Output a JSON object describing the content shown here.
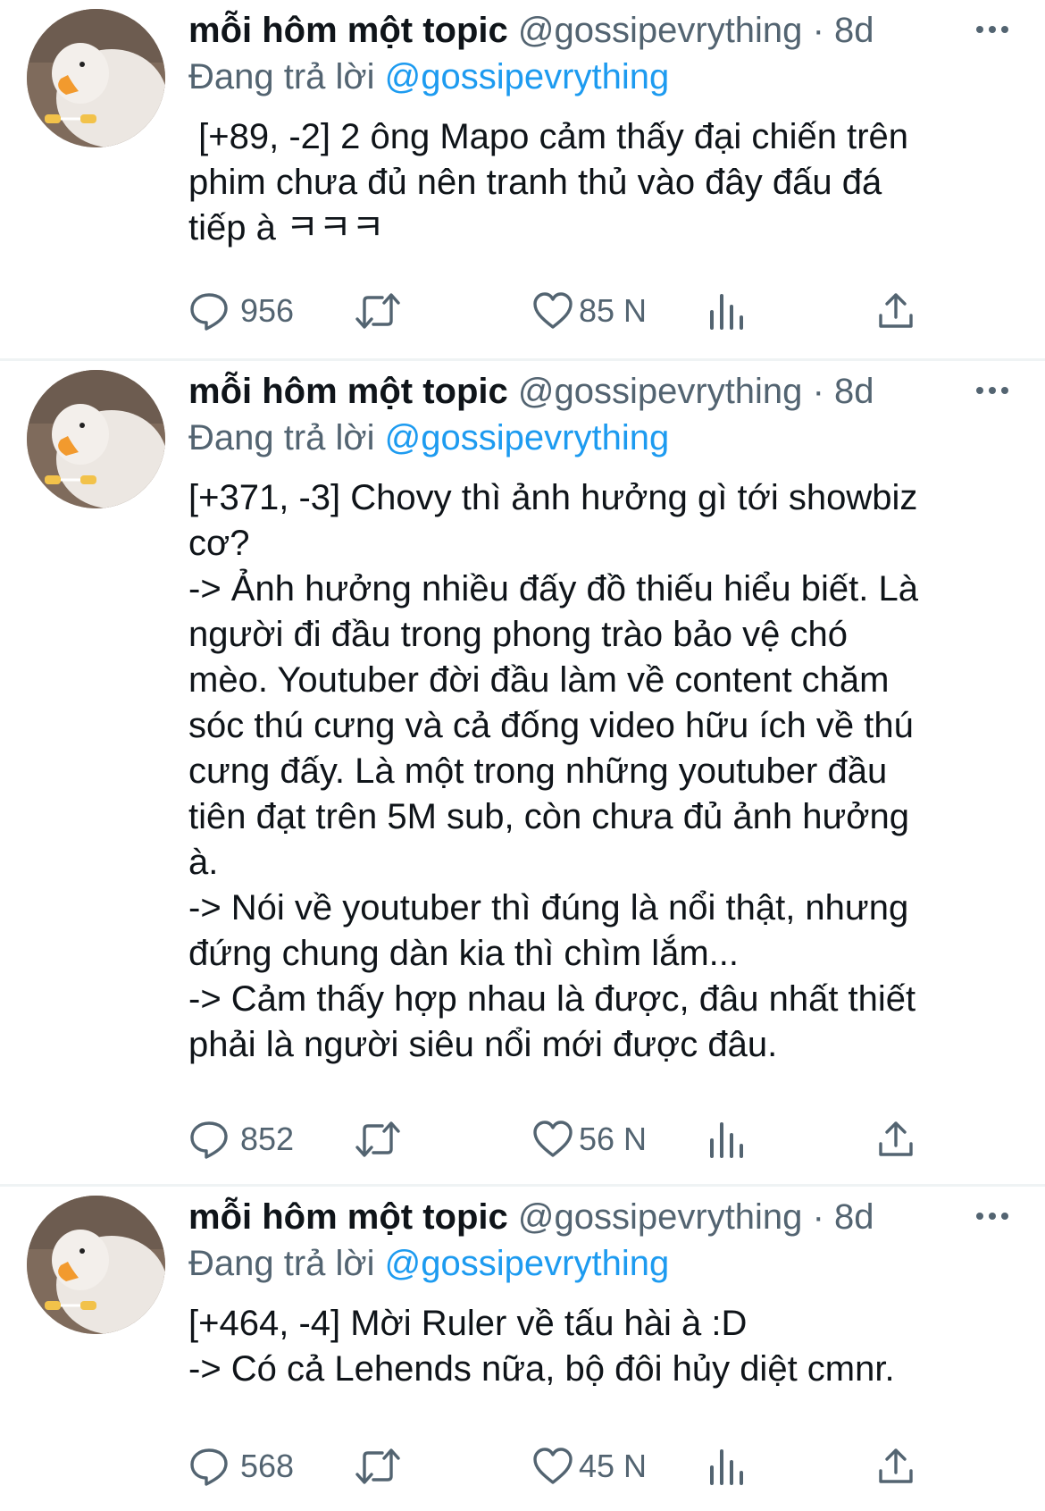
{
  "tweets": [
    {
      "author_name": "mỗi hôm một topic",
      "handle": "@gossipevrything",
      "separator": "·",
      "time": "8d",
      "reply_prefix": "Đang trả lời",
      "reply_to": "@gossipevrything",
      "text": " [+89, -2] 2 ông Mapo cảm thấy đại chiến trên\nphim chưa đủ nên tranh thủ vào đây đấu đá\ntiếp à ㅋㅋㅋ",
      "replies": "956",
      "likes": "85 N"
    },
    {
      "author_name": "mỗi hôm một topic",
      "handle": "@gossipevrything",
      "separator": "·",
      "time": "8d",
      "reply_prefix": "Đang trả lời",
      "reply_to": "@gossipevrything",
      "text": "[+371, -3] Chovy thì ảnh hưởng gì tới showbiz\ncơ?\n-> Ảnh hưởng nhiều đấy đồ thiếu hiểu biết. Là\nngười đi đầu trong phong trào bảo vệ chó\nmèo. Youtuber đời đầu làm về content chăm\nsóc thú cưng và cả đống video hữu ích về thú\ncưng đấy. Là một trong những youtuber đầu\ntiên đạt trên 5M sub, còn chưa đủ ảnh hưởng\nà.\n-> Nói về youtuber thì đúng là nổi thật, nhưng\nđứng chung dàn kia thì chìm lắm...\n-> Cảm thấy hợp nhau là được, đâu nhất thiết\nphải là người siêu nổi mới được đâu.",
      "replies": "852",
      "likes": "56 N"
    },
    {
      "author_name": "mỗi hôm một topic",
      "handle": "@gossipevrything",
      "separator": "·",
      "time": "8d",
      "reply_prefix": "Đang trả lời",
      "reply_to": "@gossipevrything",
      "text": "[+464, -4] Mời Ruler về tấu hài à :D\n-> Có cả Lehends nữa, bộ đôi hủy diệt cmnr.",
      "replies": "568",
      "likes": "45 N"
    }
  ],
  "colors": {
    "text": "#0f1419",
    "secondary": "#536471",
    "link": "#1d9bf0",
    "divider": "#eff3f4"
  },
  "icons": [
    "avatar-duck",
    "more-icon",
    "reply-icon",
    "retweet-icon",
    "like-icon",
    "views-icon",
    "share-icon"
  ]
}
